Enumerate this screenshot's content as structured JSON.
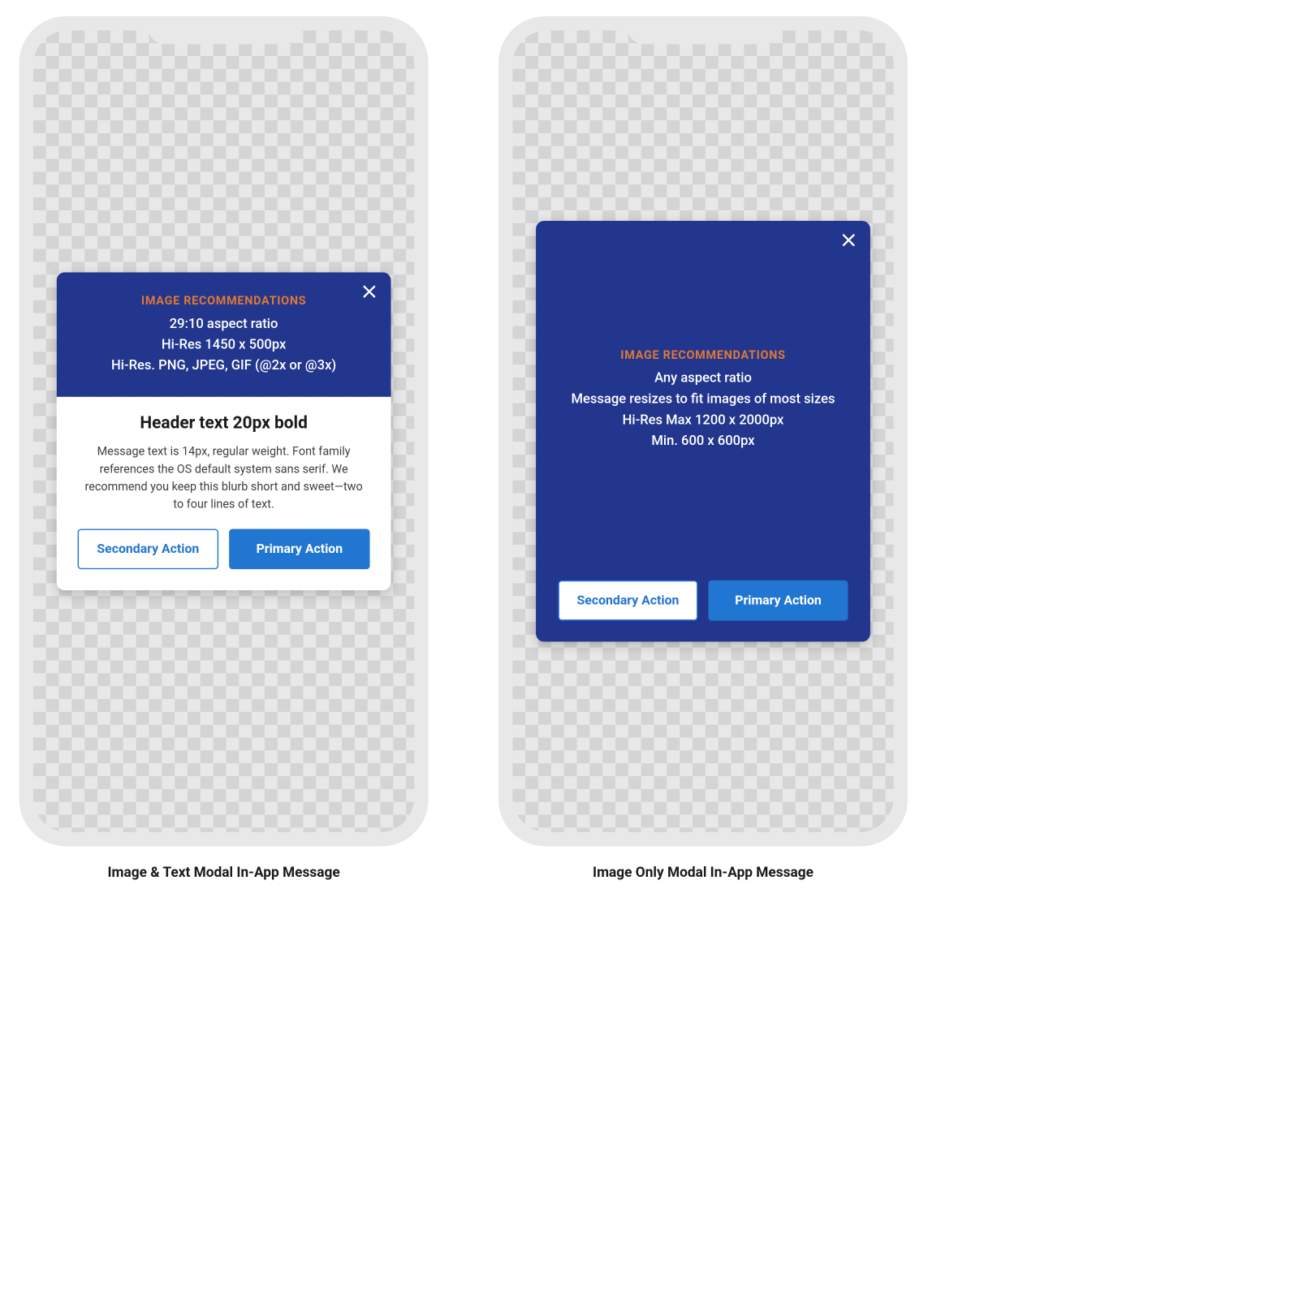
{
  "left": {
    "caption": "Image & Text Modal In-App Message",
    "image": {
      "label": "IMAGE RECOMMENDATIONS",
      "line1": "29:10 aspect ratio",
      "line2": "Hi-Res 1450 x 500px",
      "line3": "Hi-Res. PNG, JPEG, GIF (@2x or @3x)"
    },
    "header": "Header text 20px bold",
    "message": "Message text is 14px, regular weight. Font family references the OS default system sans serif. We recommend you keep this blurb short and sweet—two to four lines of text.",
    "secondary": "Secondary Action",
    "primary": "Primary Action"
  },
  "right": {
    "caption": "Image Only Modal In-App Message",
    "image": {
      "label": "IMAGE RECOMMENDATIONS",
      "line1": "Any aspect ratio",
      "line2": "Message resizes to fit images of most sizes",
      "line3": "Hi-Res Max 1200 x 2000px",
      "line4": "Min. 600 x 600px"
    },
    "secondary": "Secondary Action",
    "primary": "Primary Action"
  }
}
